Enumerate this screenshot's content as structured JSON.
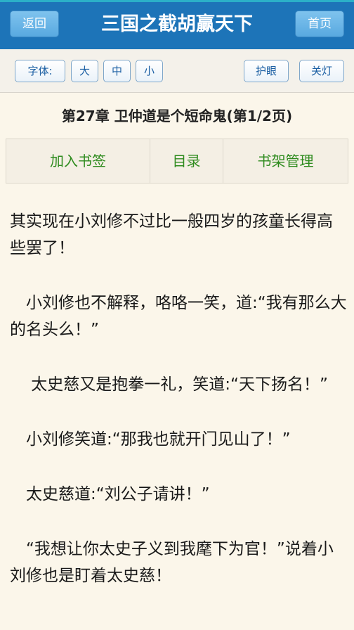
{
  "header": {
    "back_label": "返回",
    "title": "三国之截胡赢天下",
    "home_label": "首页"
  },
  "toolbar": {
    "font_label": "字体:",
    "large": "大",
    "medium": "中",
    "small": "小",
    "eye_care": "护眼",
    "lights_off": "关灯"
  },
  "chapter": {
    "title": "第27章 卫仲道是个短命鬼(第1/2页)"
  },
  "nav": {
    "bookmark": "加入书签",
    "toc": "目录",
    "shelf": "书架管理"
  },
  "content": {
    "paragraphs": [
      "其实现在小刘修不过比一般四岁的孩童长得高些罢了！",
      "　小刘修也不解释，咯咯一笑，道:“我有那么大的名头么！”",
      "　 太史慈又是抱拳一礼，笑道:“天下扬名！”",
      "　小刘修笑道:“那我也就开门见山了！”",
      "　太史慈道:“刘公子请讲！”",
      "　“我想让你太史子义到我麾下为官！”说着小刘修也是盯着太史慈！"
    ]
  },
  "colors": {
    "header_bg": "#1d74b8",
    "accent_green": "#2e8b1e",
    "page_bg": "#fbf6ea",
    "button_text": "#1b5fa3"
  }
}
